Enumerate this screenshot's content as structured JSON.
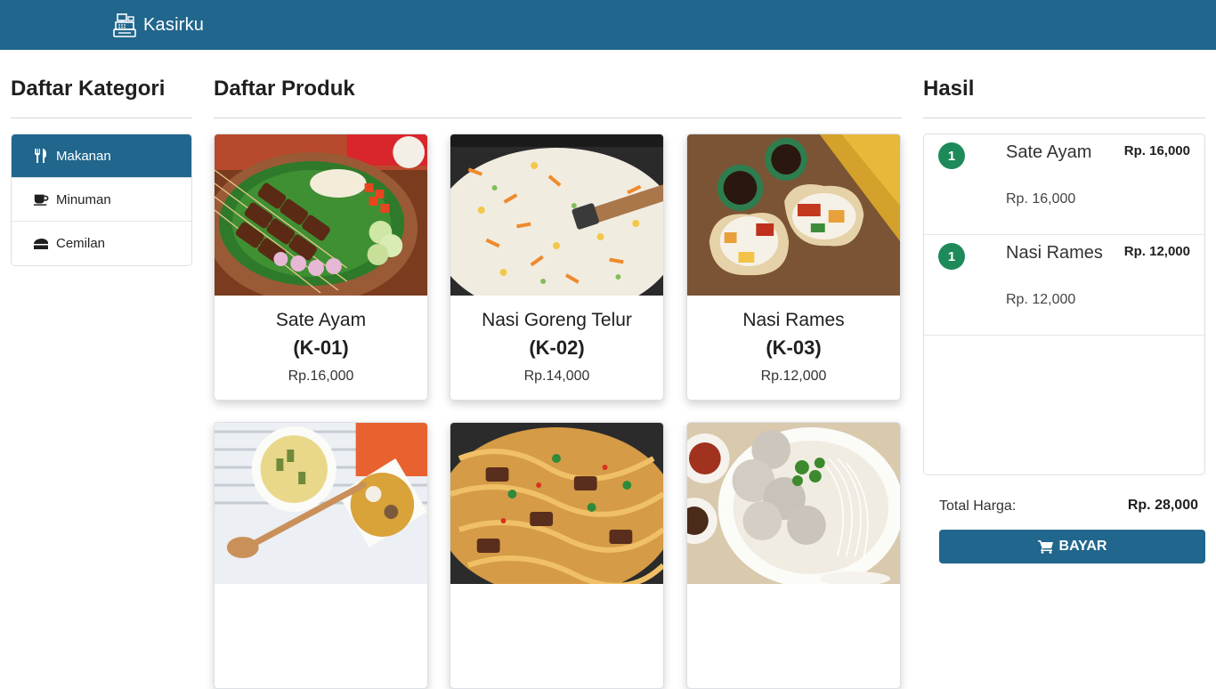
{
  "navbar": {
    "brand": "Kasirku"
  },
  "categories": {
    "title": "Daftar Kategori",
    "items": [
      {
        "label": "Makanan",
        "icon": "utensils-icon",
        "active": true
      },
      {
        "label": "Minuman",
        "icon": "coffee-icon",
        "active": false
      },
      {
        "label": "Cemilan",
        "icon": "cheese-icon",
        "active": false
      }
    ]
  },
  "products": {
    "title": "Daftar Produk",
    "items": [
      {
        "name": "Sate Ayam",
        "code": "(K-01)",
        "price": "Rp.16,000"
      },
      {
        "name": "Nasi Goreng Telur",
        "code": "(K-02)",
        "price": "Rp.14,000"
      },
      {
        "name": "Nasi Rames",
        "code": "(K-03)",
        "price": "Rp.12,000"
      },
      {
        "name": "",
        "code": "",
        "price": ""
      },
      {
        "name": "",
        "code": "",
        "price": ""
      },
      {
        "name": "",
        "code": "",
        "price": ""
      }
    ]
  },
  "result": {
    "title": "Hasil",
    "items": [
      {
        "qty": "1",
        "name": "Sate Ayam",
        "unit_price": "Rp. 16,000",
        "total": "Rp. 16,000"
      },
      {
        "qty": "1",
        "name": "Nasi Rames",
        "unit_price": "Rp. 12,000",
        "total": "Rp. 12,000"
      }
    ],
    "total_label": "Total Harga:",
    "total_value": "Rp. 28,000",
    "pay_label": "BAYAR"
  },
  "colors": {
    "primary": "#21668c",
    "badge": "#1e8a5a"
  }
}
